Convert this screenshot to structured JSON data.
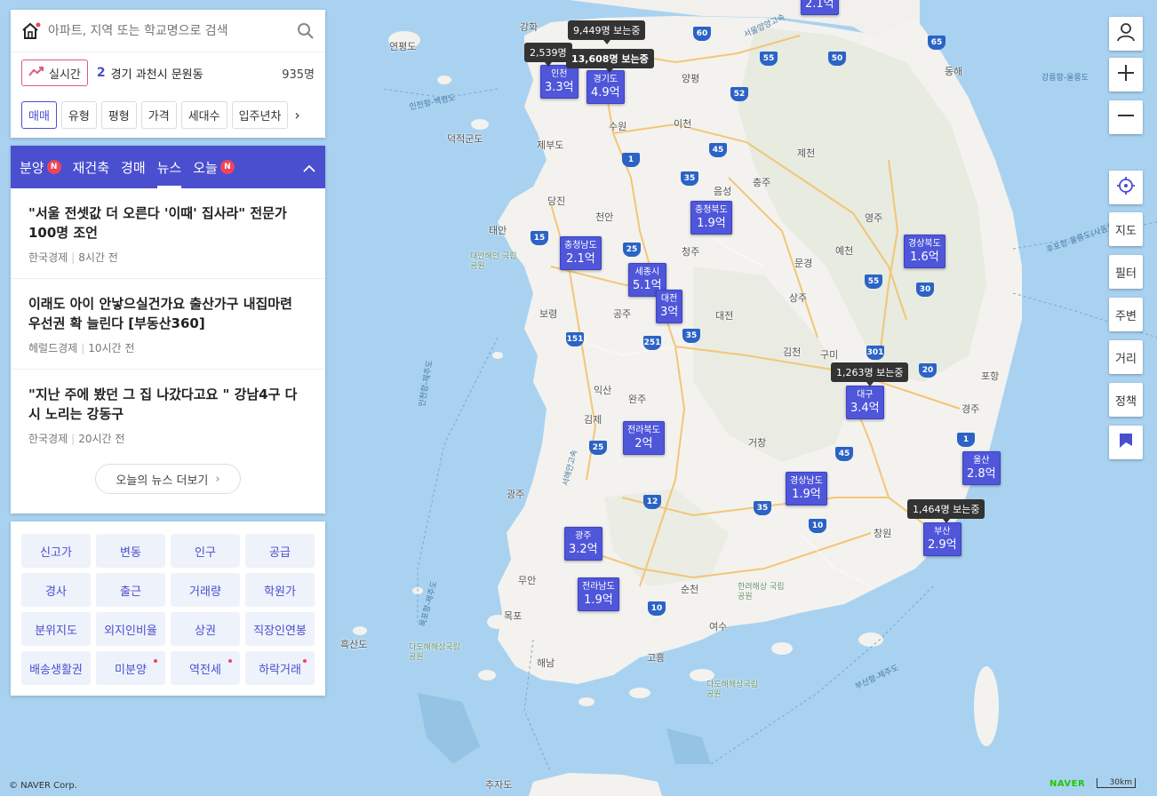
{
  "search": {
    "placeholder": "아파트, 지역 또는 학교명으로 검색"
  },
  "realtime": {
    "label": "실시간",
    "rank": "2",
    "text": "경기 과천시 문원동",
    "count": "935명"
  },
  "filters": [
    "매매",
    "유형",
    "평형",
    "가격",
    "세대수",
    "입주년차"
  ],
  "news_tabs": [
    {
      "label": "분양",
      "badge": "N"
    },
    {
      "label": "재건축",
      "badge": ""
    },
    {
      "label": "경매",
      "badge": ""
    },
    {
      "label": "뉴스",
      "badge": ""
    },
    {
      "label": "오늘",
      "badge": "N"
    }
  ],
  "news": [
    {
      "title": "\"서울 전셋값 더 오른다 '이때' 집사라\" 전문가 100명 조언",
      "source": "한국경제",
      "time": "8시간 전"
    },
    {
      "title": "이래도 아이 안낳으실건가요 출산가구 내집마련 우선권 확 늘린다 [부동산360]",
      "source": "헤럴드경제",
      "time": "10시간 전"
    },
    {
      "title": "\"지난 주에 봤던 그 집 나갔다고요 \" 강남4구 다시 노리는 강동구",
      "source": "한국경제",
      "time": "20시간 전"
    }
  ],
  "more_news": "오늘의 뉴스 더보기",
  "grid_buttons": [
    {
      "label": "신고가",
      "dot": false
    },
    {
      "label": "변동",
      "dot": false
    },
    {
      "label": "인구",
      "dot": false
    },
    {
      "label": "공급",
      "dot": false
    },
    {
      "label": "경사",
      "dot": false
    },
    {
      "label": "출근",
      "dot": false
    },
    {
      "label": "거래량",
      "dot": false
    },
    {
      "label": "학원가",
      "dot": false
    },
    {
      "label": "분위지도",
      "dot": false
    },
    {
      "label": "외지인비율",
      "dot": false
    },
    {
      "label": "상권",
      "dot": false
    },
    {
      "label": "직장인연봉",
      "dot": false
    },
    {
      "label": "배송생활권",
      "dot": false
    },
    {
      "label": "미분양",
      "dot": true
    },
    {
      "label": "역전세",
      "dot": true
    },
    {
      "label": "하락거래",
      "dot": true
    }
  ],
  "right_controls": [
    "지도",
    "필터",
    "주변",
    "거리",
    "정책"
  ],
  "regions": [
    {
      "id": "top",
      "name": "",
      "price": "2.1억"
    },
    {
      "id": "incheon",
      "name": "인천",
      "price": "3.3억"
    },
    {
      "id": "gyeonggi",
      "name": "경기도",
      "price": "4.9억"
    },
    {
      "id": "chungbuk",
      "name": "충청북도",
      "price": "1.9억"
    },
    {
      "id": "chungnam",
      "name": "충청남도",
      "price": "2.1억"
    },
    {
      "id": "sejong",
      "name": "세종시",
      "price": "5.1억"
    },
    {
      "id": "daejeon",
      "name": "대전",
      "price": "3억"
    },
    {
      "id": "gyeongbuk",
      "name": "경상북도",
      "price": "1.6억"
    },
    {
      "id": "daegu",
      "name": "대구",
      "price": "3.4억"
    },
    {
      "id": "jeonbuk",
      "name": "전라북도",
      "price": "2억"
    },
    {
      "id": "ulsan",
      "name": "울산",
      "price": "2.8억"
    },
    {
      "id": "gyeongnam",
      "name": "경상남도",
      "price": "1.9억"
    },
    {
      "id": "busan",
      "name": "부산",
      "price": "2.9억"
    },
    {
      "id": "gwangju",
      "name": "광주",
      "price": "3.2억"
    },
    {
      "id": "jeonnam",
      "name": "전라남도",
      "price": "1.9억"
    }
  ],
  "viewers": [
    {
      "id": "seoul",
      "text": "9,449명 보는중"
    },
    {
      "id": "incheon",
      "text": "2,539명"
    },
    {
      "id": "gyeonggi",
      "text": "13,608명 보는중"
    },
    {
      "id": "daegu",
      "text": "1,263명 보는중"
    },
    {
      "id": "busan",
      "text": "1,464명 보는중"
    }
  ],
  "places": [
    "강화",
    "연평도",
    "인천",
    "양평",
    "수원",
    "이천",
    "덕적군도",
    "제부도",
    "당진",
    "천안",
    "음성",
    "충주",
    "제천",
    "영주",
    "태안",
    "청주",
    "예천",
    "문경",
    "보령",
    "공주",
    "상주",
    "구미",
    "익산",
    "완주",
    "김천",
    "김제",
    "거창",
    "경주",
    "포항",
    "창원",
    "김해",
    "광주",
    "무안",
    "목포",
    "순천",
    "여수",
    "고흥",
    "해남",
    "흑산도",
    "추자도",
    "동해",
    "대전",
    "울산"
  ],
  "sea_routes": [
    "인천항-백령도",
    "서울양양고속",
    "강릉항-울릉도",
    "후포항-울릉도(사동항)",
    "인천항-제주도",
    "목포항-제주도",
    "부산항-제주도",
    "서해안고속"
  ],
  "parks": [
    "태안해안 국립공원",
    "한려해상 국립공원",
    "다도해해상국립공원",
    "다도해해상국립공원"
  ],
  "highways": [
    "60",
    "55",
    "50",
    "65",
    "52",
    "1",
    "45",
    "35",
    "15",
    "25",
    "55",
    "30",
    "151",
    "251",
    "35",
    "301",
    "20",
    "1",
    "25",
    "45",
    "12",
    "35",
    "10",
    "10"
  ],
  "footer": {
    "copyright": "© NAVER Corp.",
    "logo": "NAVER",
    "scale": "30km"
  }
}
